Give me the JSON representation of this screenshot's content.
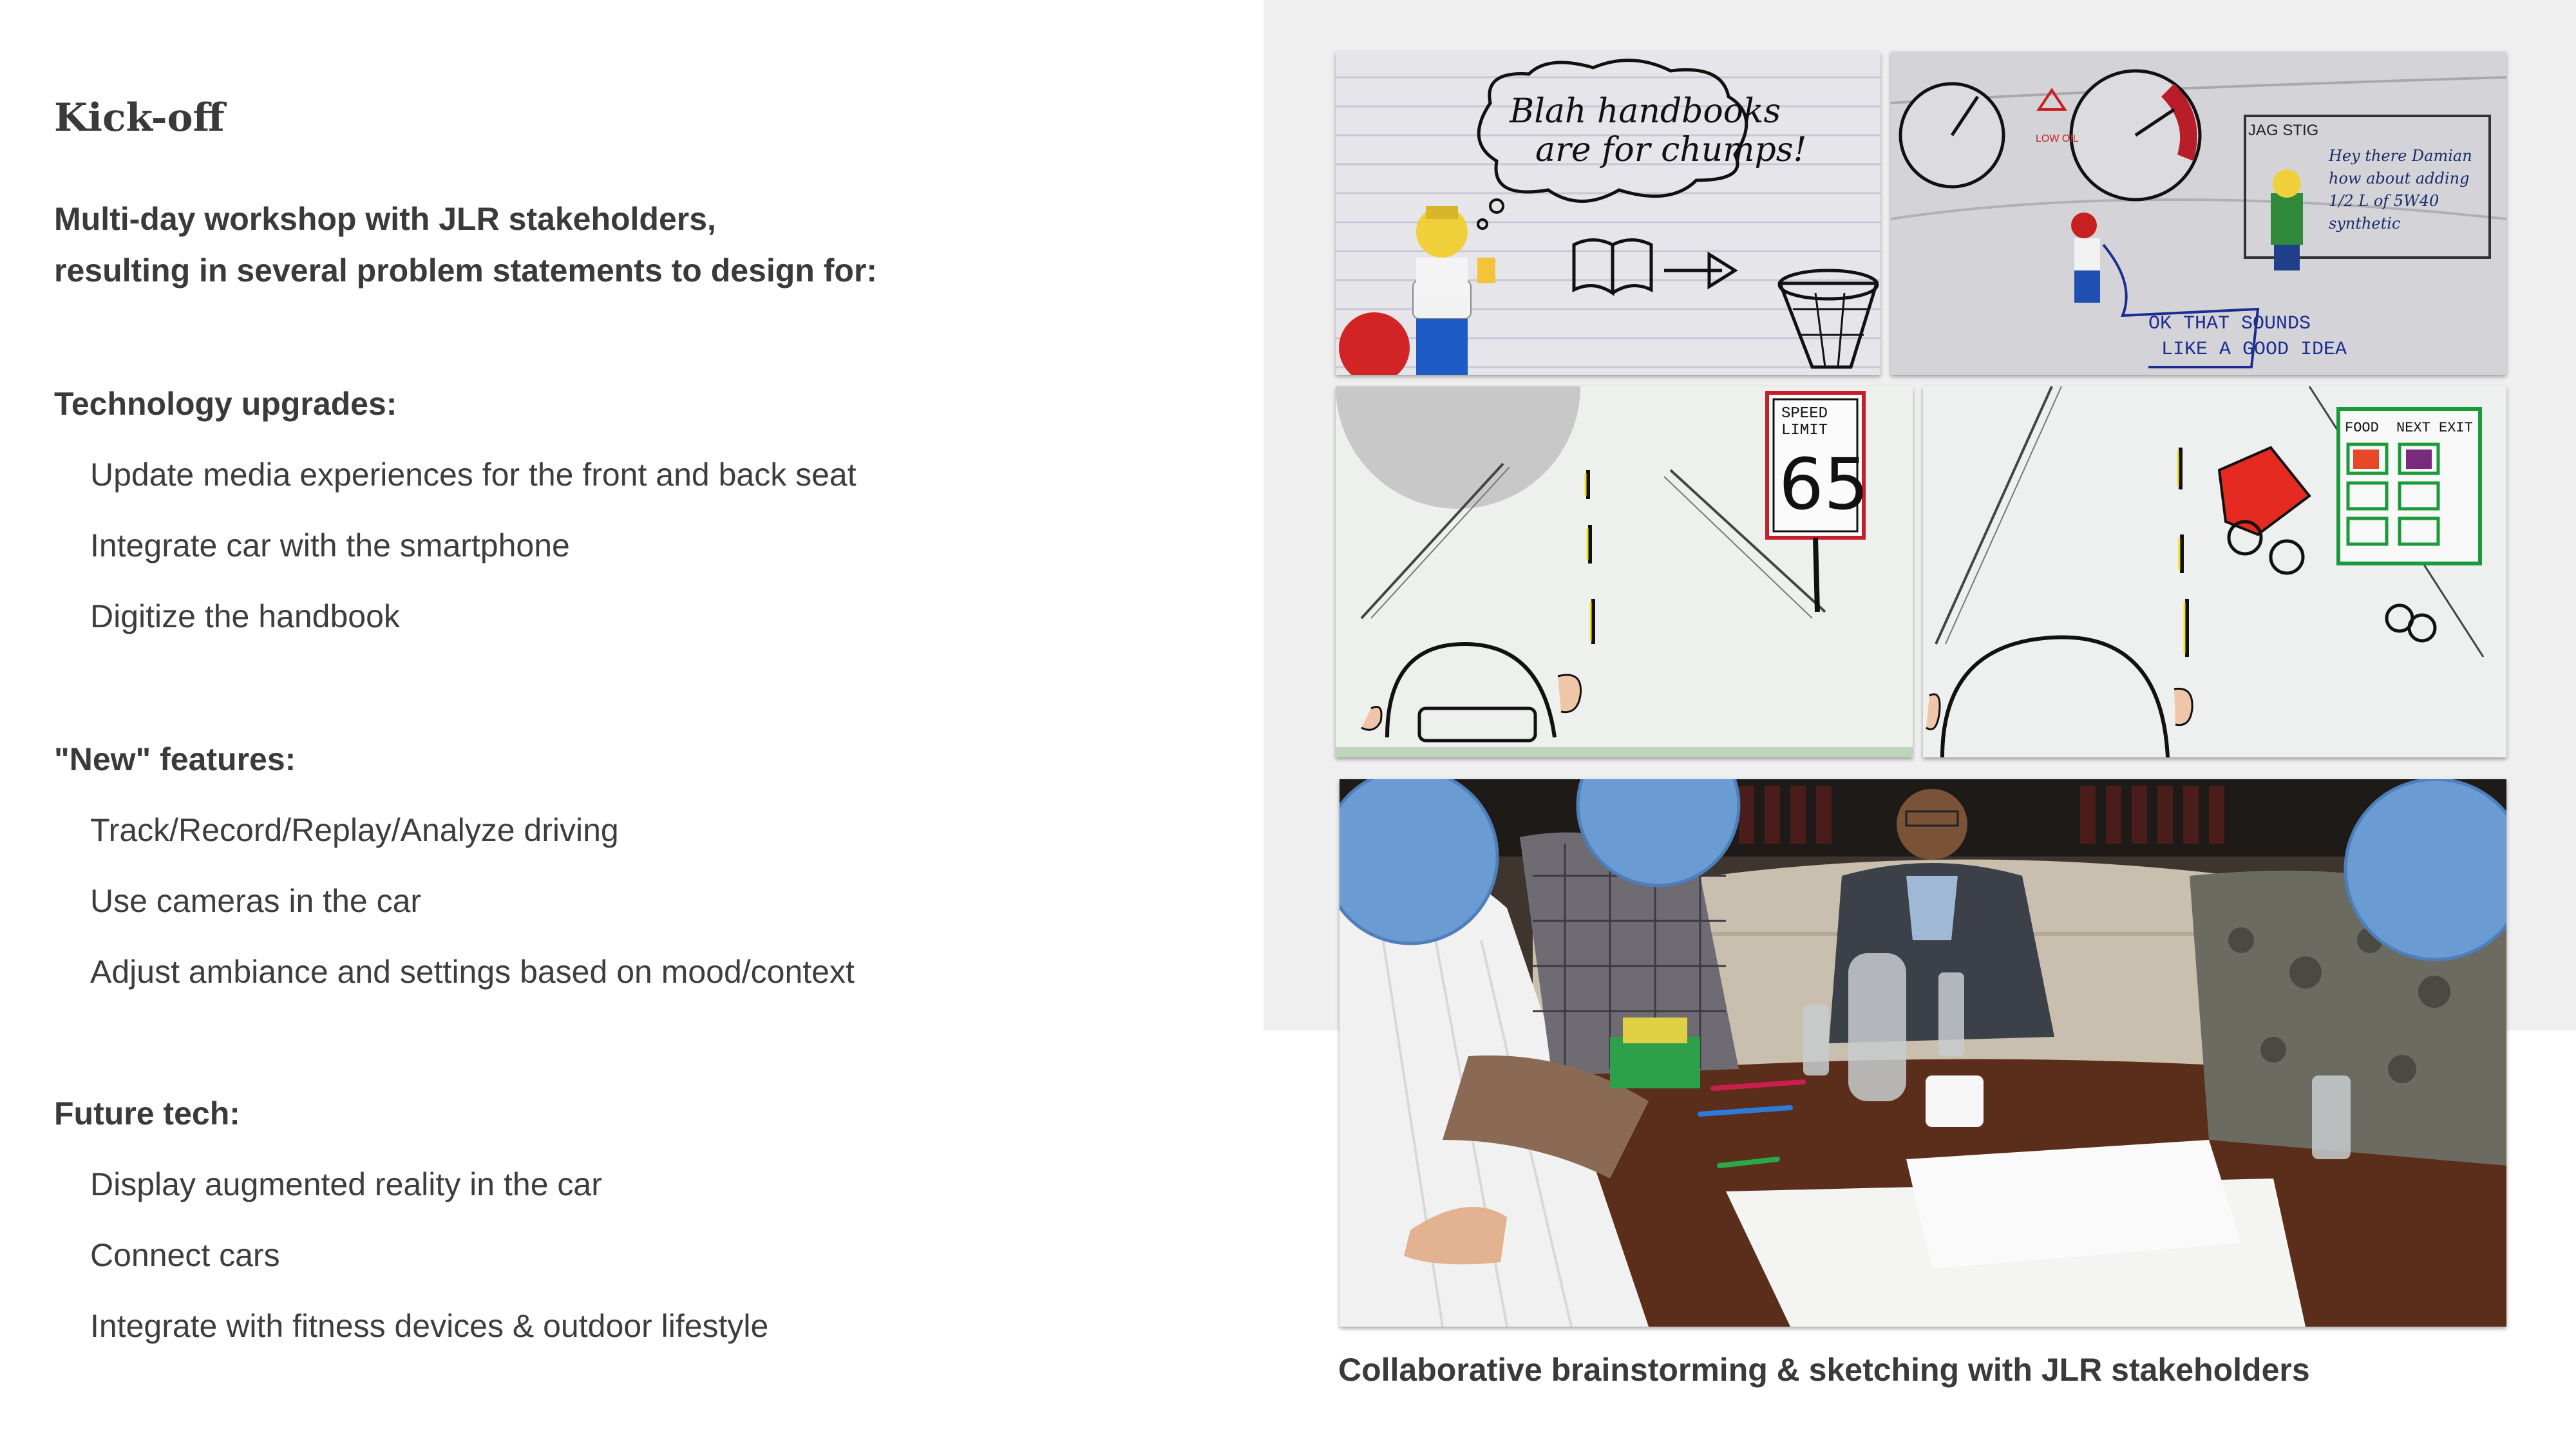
{
  "title": "Kick-off",
  "intro": {
    "line1": "Multi-day workshop with JLR stakeholders,",
    "line2": "resulting in several problem statements to design for:"
  },
  "sections": [
    {
      "heading": "Technology upgrades:",
      "items": [
        "Update media experiences for the front and back seat",
        "Integrate car with the smartphone",
        "Digitize the handbook"
      ]
    },
    {
      "heading": "\"New\" features:",
      "items": [
        "Track/Record/Replay/Analyze driving",
        "Use cameras in the car",
        "Adjust ambiance and settings based on mood/context"
      ]
    },
    {
      "heading": "Future tech:",
      "items": [
        "Display augmented reality in the car",
        "Connect cars",
        "Integrate with fitness devices & outdoor lifestyle"
      ]
    }
  ],
  "sketches": {
    "handbook": {
      "bubble_line1": "Blah handbooks",
      "bubble_line2": "are for chumps!"
    },
    "dashboard": {
      "label_small": "LOW OIL",
      "jag_label": "JAG STIG",
      "speech1": "Hey there Damian",
      "speech2": "how about adding",
      "speech3": "1/2 L of 5W40",
      "speech4": "synthetic",
      "reply1": "OK THAT SOUNDS",
      "reply2": "LIKE A GOOD IDEA"
    },
    "speed_sign": {
      "line1": "SPEED",
      "line2": "LIMIT",
      "value": "65"
    },
    "food_sign": {
      "line1": "FOOD",
      "line2": "NEXT EXIT"
    }
  },
  "caption": "Collaborative brainstorming & sketching with JLR stakeholders",
  "colors": {
    "text": "#3a3a3a",
    "panel": "#efefef",
    "blur_circle": "#6a9bd3"
  }
}
